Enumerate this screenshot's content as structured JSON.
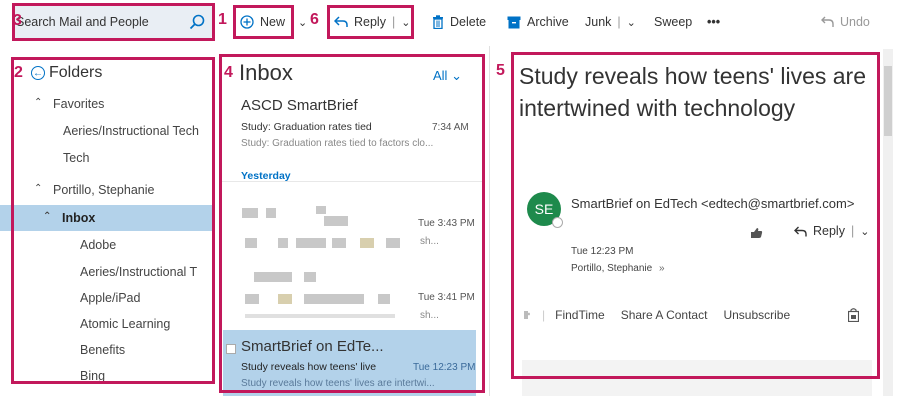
{
  "toolbar": {
    "search_placeholder": "Search Mail and People",
    "new_label": "New",
    "reply_label": "Reply",
    "delete_label": "Delete",
    "archive_label": "Archive",
    "junk_label": "Junk",
    "sweep_label": "Sweep",
    "more_label": "•••",
    "undo_label": "Undo"
  },
  "callouts": {
    "n1": "1",
    "n2": "2",
    "n3": "3",
    "n4": "4",
    "n5": "5",
    "n6": "6"
  },
  "folders": {
    "title": "Folders",
    "items": [
      {
        "label": "Favorites"
      },
      {
        "label": "Aeries/Instructional Tech"
      },
      {
        "label": "Tech"
      },
      {
        "label": "Portillo, Stephanie"
      },
      {
        "label": "Inbox"
      },
      {
        "label": "Adobe"
      },
      {
        "label": "Aeries/Instructional T"
      },
      {
        "label": "Apple/iPad"
      },
      {
        "label": "Atomic Learning"
      },
      {
        "label": "Benefits"
      },
      {
        "label": "Bing"
      }
    ]
  },
  "message_list": {
    "title": "Inbox",
    "filter": "All",
    "group_label": "Yesterday",
    "messages": [
      {
        "sender": "ASCD SmartBrief",
        "subject": "Study: Graduation rates tied",
        "time": "7:34 AM",
        "preview": "Study: Graduation rates tied to factors clo..."
      },
      {
        "time": "Tue 3:43 PM",
        "preview": "sh..."
      },
      {
        "time": "Tue 3:41 PM",
        "preview": "sh..."
      },
      {
        "sender": "SmartBrief on EdTe...",
        "subject": "Study reveals how teens' live",
        "time": "Tue 12:23 PM",
        "preview": "Study reveals how teens' lives are intertwi..."
      }
    ]
  },
  "reading_pane": {
    "subject": "Study reveals how teens' lives are intertwined with technology",
    "avatar_initials": "SE",
    "from": "SmartBrief on EdTech <edtech@smartbrief.com>",
    "reply_label": "Reply",
    "time": "Tue 12:23 PM",
    "to": "Portillo, Stephanie",
    "addins": [
      "FindTime",
      "Share A Contact",
      "Unsubscribe"
    ]
  },
  "colors": {
    "accent": "#0072c6",
    "callout": "#c2185b",
    "selected": "#b3d2ea",
    "avatar": "#1e8a4c"
  }
}
